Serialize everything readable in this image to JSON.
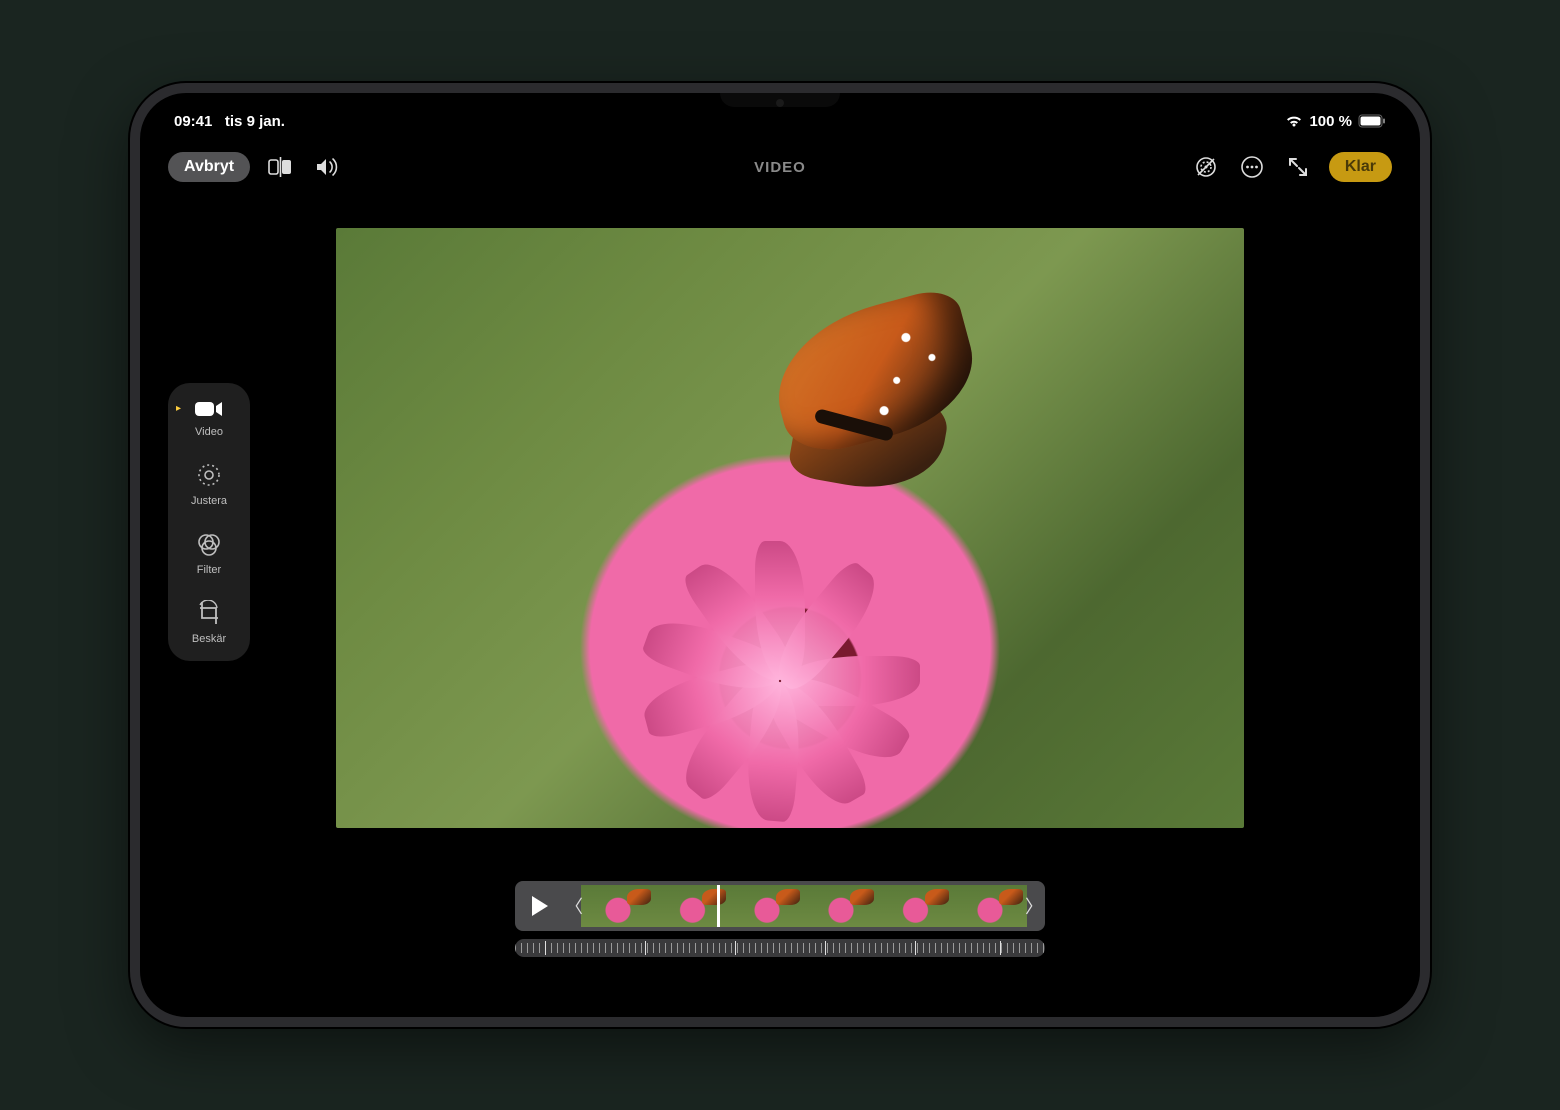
{
  "status": {
    "time": "09:41",
    "date": "tis 9 jan.",
    "battery_pct": "100 %"
  },
  "topbar": {
    "cancel_label": "Avbryt",
    "title": "VIDEO",
    "done_label": "Klar",
    "icons": {
      "compare": "compare-icon",
      "volume": "volume-icon",
      "liveoff": "liveoff-icon",
      "more": "ellipsis-circle-icon",
      "fullscreen": "expand-icon"
    }
  },
  "sidebar": {
    "items": [
      {
        "id": "video",
        "label": "Video",
        "active": true
      },
      {
        "id": "justera",
        "label": "Justera",
        "active": false
      },
      {
        "id": "filter",
        "label": "Filter",
        "active": false
      },
      {
        "id": "beskar",
        "label": "Beskär",
        "active": false
      }
    ]
  },
  "timeline": {
    "play_icon": "play-icon",
    "frame_count": 6
  }
}
